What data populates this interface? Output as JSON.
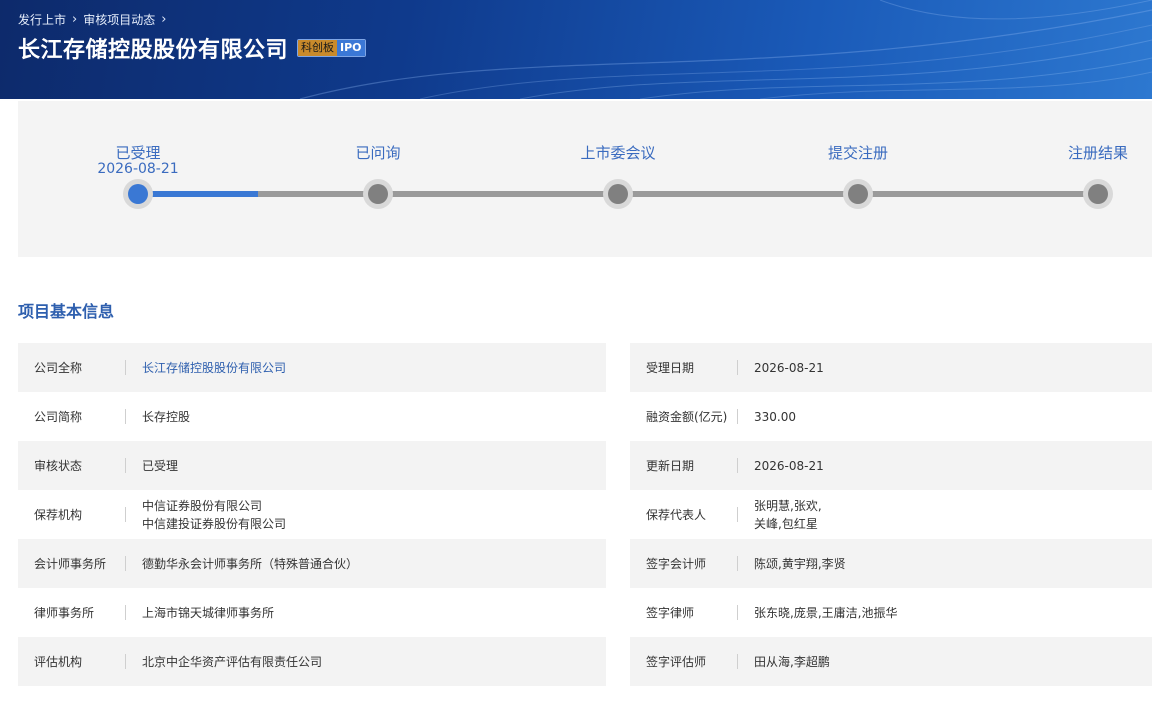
{
  "breadcrumb": [
    "发行上市",
    "审核项目动态"
  ],
  "title": "长江存储控股股份有限公司",
  "badge": {
    "board": "科创板",
    "type": "IPO"
  },
  "progress": {
    "fraction": 0.125,
    "steps": [
      {
        "label": "已受理",
        "date": "2026-08-21",
        "active": true
      },
      {
        "label": "已问询",
        "date": "",
        "active": false
      },
      {
        "label": "上市委会议",
        "date": "",
        "active": false
      },
      {
        "label": "提交注册",
        "date": "",
        "active": false
      },
      {
        "label": "注册结果",
        "date": "",
        "active": false
      }
    ]
  },
  "section_title": "项目基本信息",
  "left_rows": [
    {
      "label": "公司全称",
      "lines": [
        "长江存储控股股份有限公司"
      ]
    },
    {
      "label": "公司简称",
      "lines": [
        "长存控股"
      ]
    },
    {
      "label": "审核状态",
      "lines": [
        "已受理"
      ]
    },
    {
      "label": "保荐机构",
      "lines": [
        "中信证券股份有限公司",
        "中信建投证券股份有限公司"
      ]
    },
    {
      "label": "会计师事务所",
      "lines": [
        "德勤华永会计师事务所（特殊普通合伙）"
      ]
    },
    {
      "label": "律师事务所",
      "lines": [
        "上海市锦天城律师事务所"
      ]
    },
    {
      "label": "评估机构",
      "lines": [
        "北京中企华资产评估有限责任公司"
      ]
    }
  ],
  "right_rows": [
    {
      "label": "受理日期",
      "lines": [
        "2026-08-21"
      ]
    },
    {
      "label": "融资金额(亿元)",
      "lines": [
        "330.00"
      ]
    },
    {
      "label": "更新日期",
      "lines": [
        "2026-08-21"
      ]
    },
    {
      "label": "保荐代表人",
      "lines": [
        "张明慧,张欢,",
        "关峰,包红星"
      ]
    },
    {
      "label": "签字会计师",
      "lines": [
        "陈颂,黄宇翔,李贤"
      ]
    },
    {
      "label": "签字律师",
      "lines": [
        "张东晓,庞景,王庸洁,池振华"
      ]
    },
    {
      "label": "签字评估师",
      "lines": [
        "田从海,李超鹏"
      ]
    }
  ]
}
